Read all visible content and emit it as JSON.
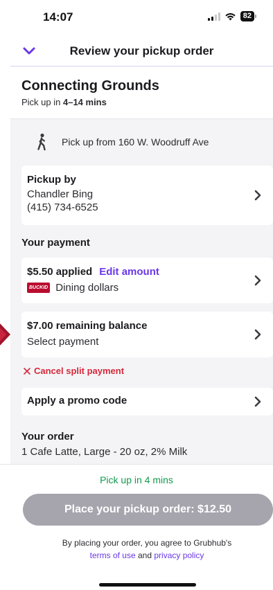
{
  "status_bar": {
    "time": "14:07",
    "battery": "82"
  },
  "header": {
    "title": "Review your pickup order"
  },
  "restaurant": {
    "name": "Connecting Grounds",
    "pickup_prefix": "Pick up in ",
    "pickup_window": "4–14 mins"
  },
  "pickup_location": {
    "text": "Pick up from 160 W. Woodruff Ave"
  },
  "pickup_by": {
    "title": "Pickup by",
    "name": "Chandler Bing",
    "phone": "(415) 734-6525"
  },
  "payment": {
    "section_title": "Your payment",
    "applied_label": "$5.50 applied",
    "edit_label": "Edit amount",
    "card_badge": "BUCKID",
    "method_name": "Dining dollars",
    "balance_label": "$7.00 remaining balance",
    "select_label": "Select payment",
    "cancel_label": "Cancel split payment"
  },
  "promo": {
    "label": "Apply a promo code"
  },
  "order": {
    "section_title": "Your order",
    "first_item": "1 Cafe Latte, Large - 20 oz, 2% Milk"
  },
  "footer": {
    "eta": "Pick up in 4 mins",
    "place_order_label": "Place your pickup order: $12.50",
    "agree_prefix": "By placing your order, you agree to Grubhub's",
    "terms_label": "terms of use",
    "and": "and",
    "privacy_label": "privacy policy"
  },
  "colors": {
    "accent": "#6b38e6",
    "success": "#0f9a4b",
    "danger": "#d6283a",
    "disabled_button": "#a6a5ad",
    "buckid": "#ba0c2f"
  }
}
